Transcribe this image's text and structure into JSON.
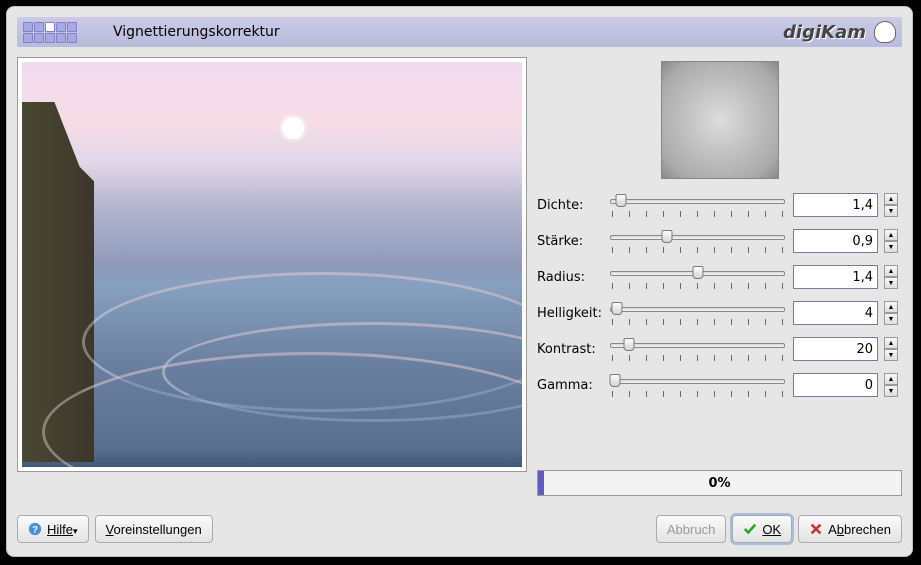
{
  "title": "Vignettierungskorrektur",
  "app_name": "digiKam",
  "params": [
    {
      "label": "Dichte:",
      "value": "1,4",
      "pos": 7,
      "ticks": 11
    },
    {
      "label": "Stärke:",
      "value": "0,9",
      "pos": 33,
      "ticks": 11
    },
    {
      "label": "Radius:",
      "value": "1,4",
      "pos": 50,
      "ticks": 11
    },
    {
      "label": "Helligkeit:",
      "value": "4",
      "pos": 5,
      "ticks": 11
    },
    {
      "label": "Kontrast:",
      "value": "20",
      "pos": 12,
      "ticks": 11
    },
    {
      "label": "Gamma:",
      "value": "0",
      "pos": 4,
      "ticks": 11
    }
  ],
  "progress_text": "0%",
  "footer": {
    "help": "Hilfe",
    "presets": "Voreinstellungen",
    "abort": "Abbruch",
    "ok": "OK",
    "cancel": "Abbrechen"
  }
}
